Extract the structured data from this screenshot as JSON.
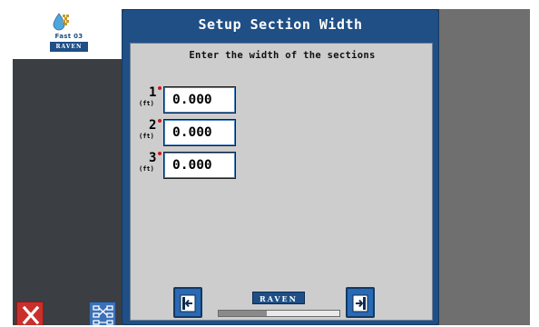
{
  "left_panel": {
    "logo": {
      "product_line": "Fast 03",
      "brand": "RAVEN"
    }
  },
  "dialog": {
    "title": "Setup Section Width",
    "instruction": "Enter the width of the sections",
    "sections": [
      {
        "number": "1",
        "unit": "(ft)",
        "value": "0.000"
      },
      {
        "number": "2",
        "unit": "(ft)",
        "value": "0.000"
      },
      {
        "number": "3",
        "unit": "(ft)",
        "value": "0.000"
      }
    ],
    "footer": {
      "brand": "RAVEN",
      "progress": 0.4
    }
  },
  "colors": {
    "title_bar": "#1f4f85",
    "body": "#cdcdcd",
    "cancel": "#c9302c",
    "nav_button": "#2a69b3"
  }
}
